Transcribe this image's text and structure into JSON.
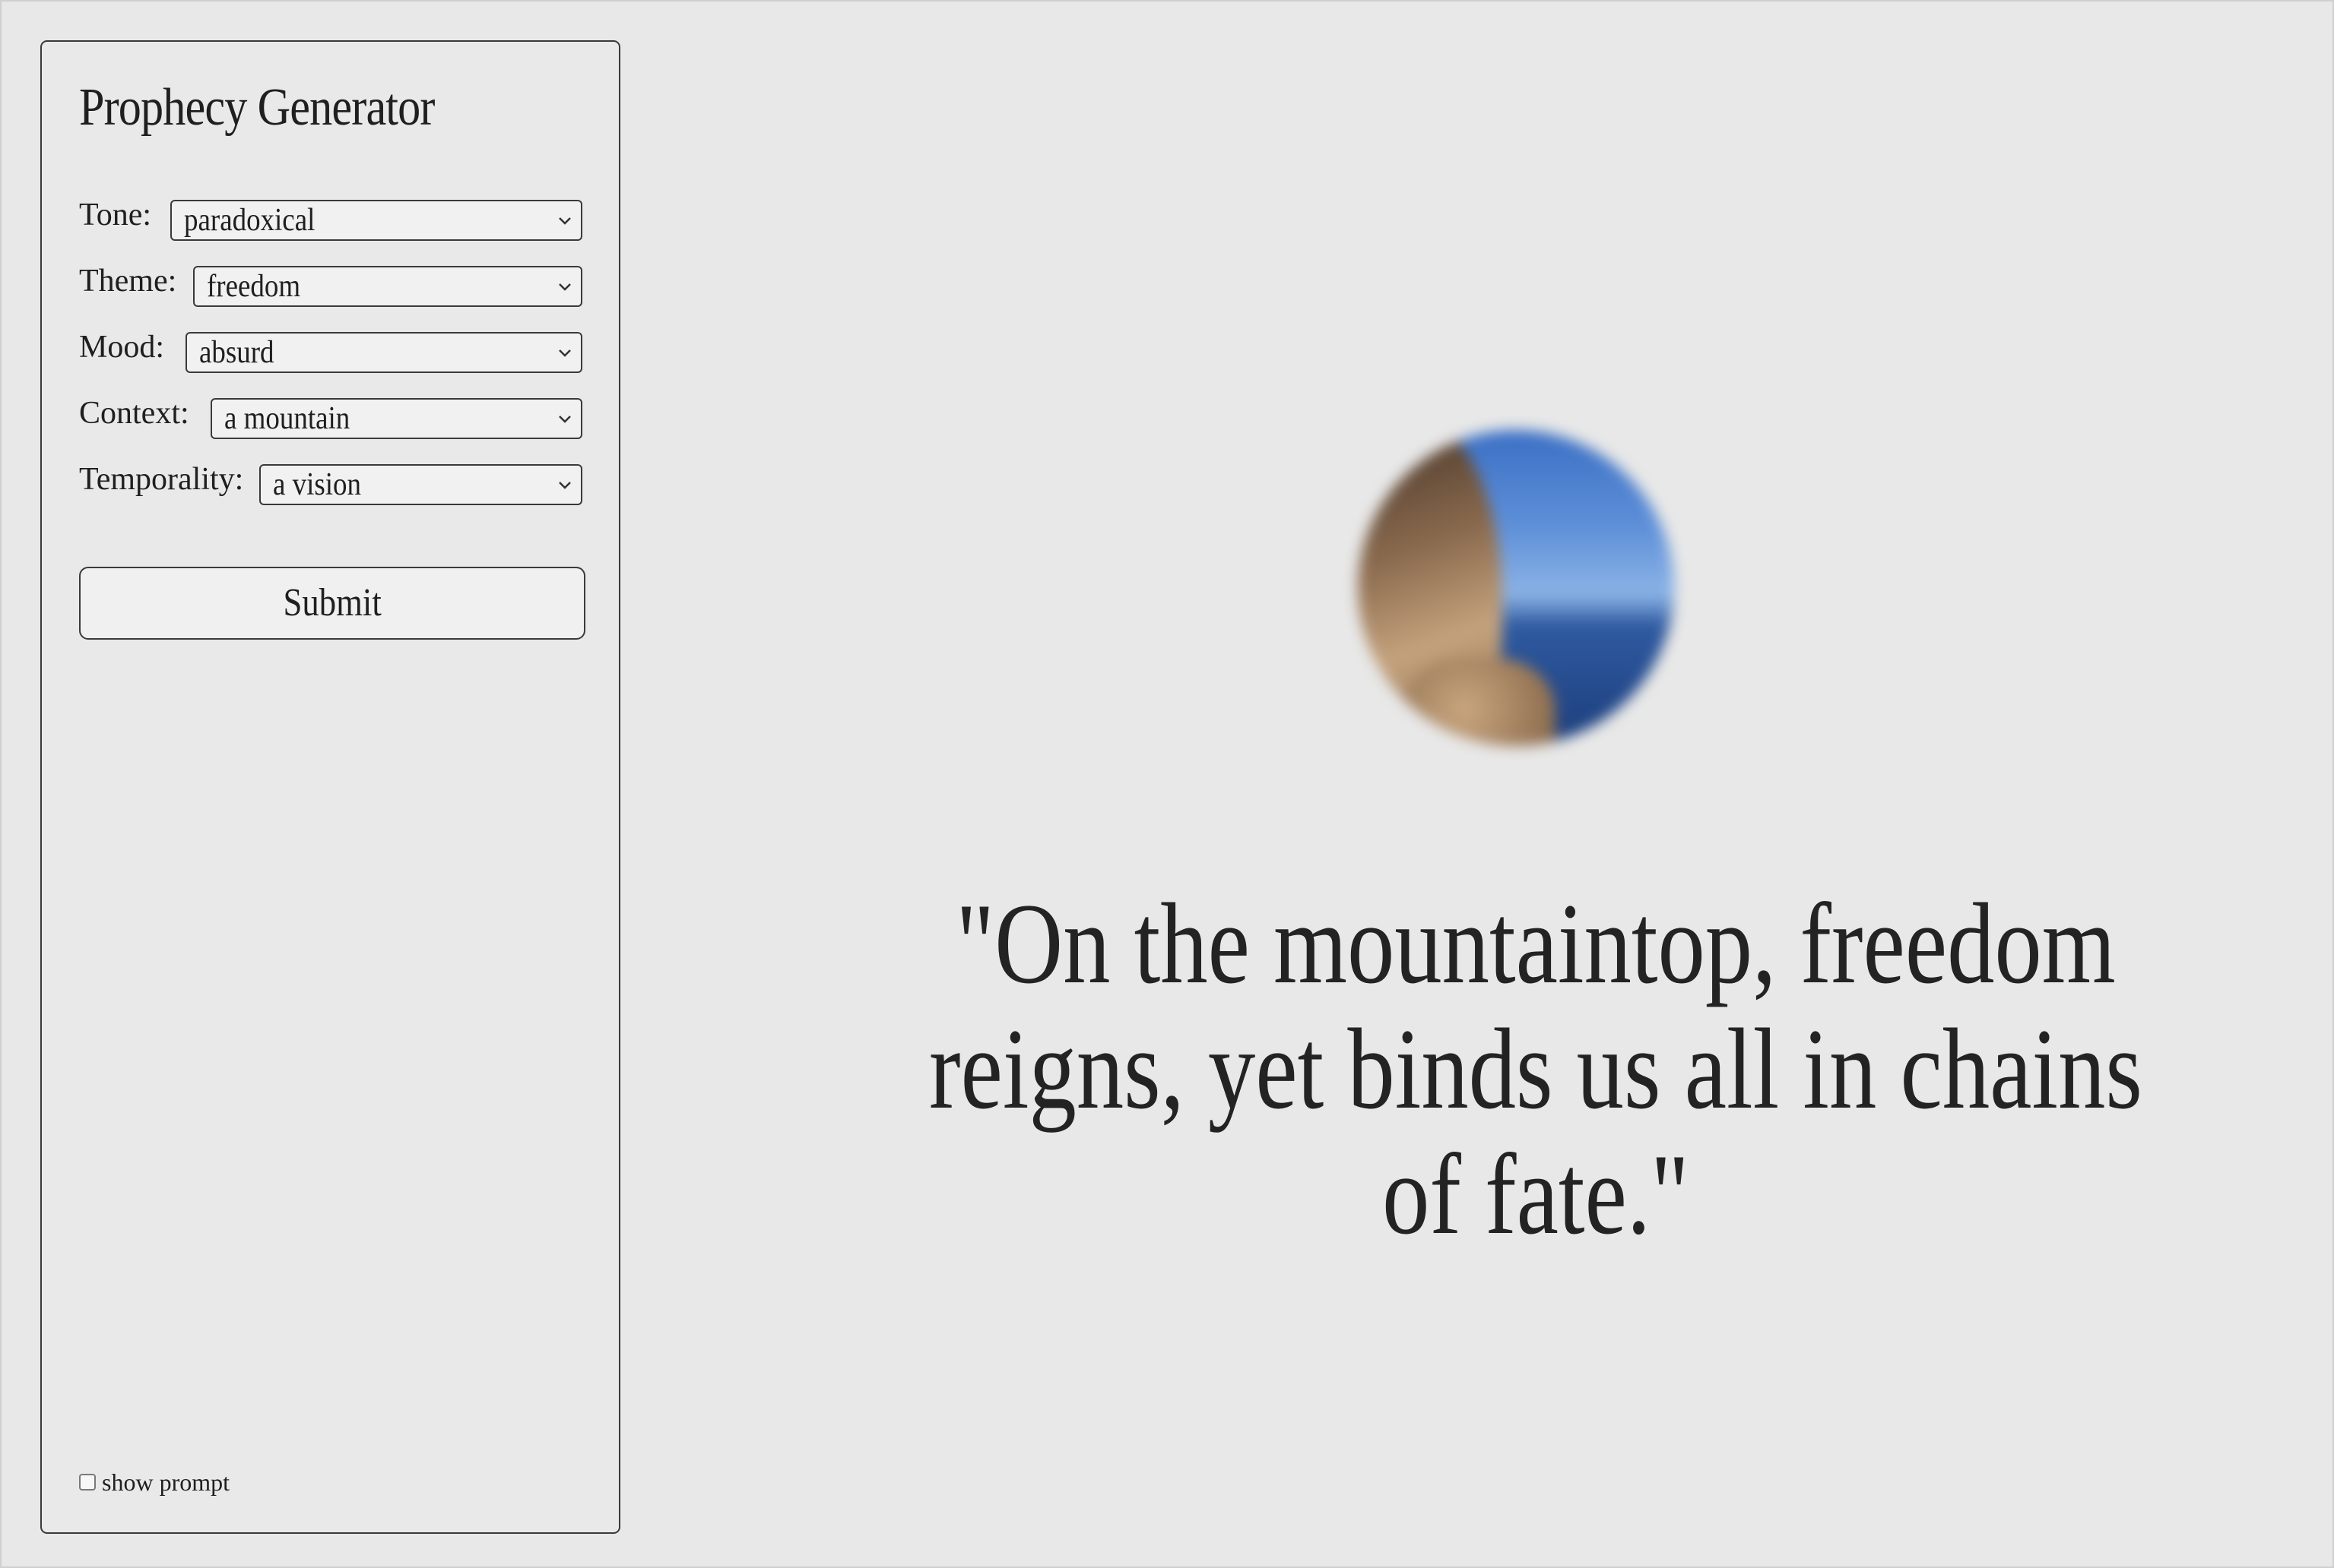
{
  "panel": {
    "title": "Prophecy Generator",
    "fields": [
      {
        "label": "Tone:",
        "value": "paradoxical"
      },
      {
        "label": "Theme:",
        "value": "freedom"
      },
      {
        "label": "Mood:",
        "value": "absurd"
      },
      {
        "label": "Context:",
        "value": "a mountain"
      },
      {
        "label": "Temporality:",
        "value": "a vision"
      }
    ],
    "submit_label": "Submit",
    "show_prompt_label": "show prompt",
    "show_prompt_checked": false
  },
  "prophecy": {
    "text": "\"On the mountaintop, freedom reigns, yet binds us all in chains of fate.\"",
    "image_icon": "blurred-mountain-sky-orb"
  }
}
